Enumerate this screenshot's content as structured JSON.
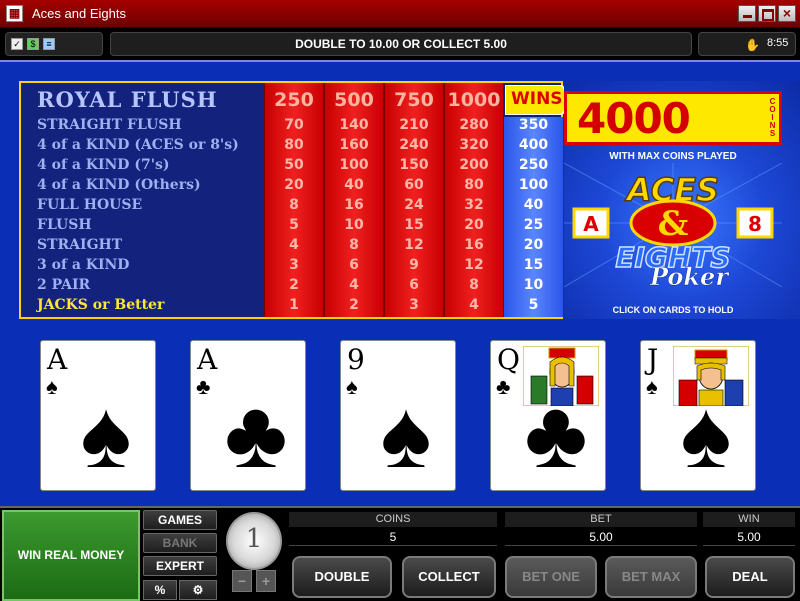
{
  "window": {
    "title": "Aces and Eights",
    "close_glyph": "×",
    "app_icon_glyph": "▦"
  },
  "infobar": {
    "message": "DOUBLE TO 10.00 OR COLLECT 5.00",
    "clock": "8:55",
    "icons": [
      "checklist-icon",
      "money-icon",
      "info-icon"
    ],
    "sound_glyph": "✋"
  },
  "paytable": {
    "hands": [
      "ROYAL FLUSH",
      "STRAIGHT FLUSH",
      "4 of a KIND (ACES or 8's)",
      "4 of a KIND (7's)",
      "4 of a KIND (Others)",
      "FULL HOUSE",
      "FLUSH",
      "STRAIGHT",
      "3 of a KIND",
      "2 PAIR",
      "JACKS or Better"
    ],
    "columns": [
      {
        "head": "250",
        "values": [
          "70",
          "80",
          "50",
          "20",
          "8",
          "5",
          "4",
          "3",
          "2",
          "1"
        ]
      },
      {
        "head": "500",
        "values": [
          "140",
          "160",
          "100",
          "40",
          "16",
          "10",
          "8",
          "6",
          "4",
          "2"
        ]
      },
      {
        "head": "750",
        "values": [
          "210",
          "240",
          "150",
          "60",
          "24",
          "15",
          "12",
          "9",
          "6",
          "3"
        ]
      },
      {
        "head": "1000",
        "values": [
          "280",
          "320",
          "200",
          "80",
          "32",
          "20",
          "16",
          "12",
          "8",
          "4"
        ]
      }
    ],
    "wins_label": "WINS",
    "wins": [
      "350",
      "400",
      "250",
      "100",
      "40",
      "25",
      "20",
      "15",
      "10",
      "5"
    ]
  },
  "promo": {
    "jackpot": "4000",
    "jackpot_unit": "COINS",
    "max_coins": "WITH MAX COINS PLAYED",
    "logo_aces": "ACES",
    "logo_a": "A",
    "logo_amp": "&",
    "logo_8": "8",
    "logo_eights": "EIGHTS",
    "logo_poker": "Poker",
    "click_hold": "CLICK ON CARDS TO HOLD"
  },
  "cards": [
    {
      "rank": "A",
      "suit": "♠",
      "suit_name": "spades"
    },
    {
      "rank": "A",
      "suit": "♣",
      "suit_name": "clubs"
    },
    {
      "rank": "9",
      "suit": "♠",
      "suit_name": "spades"
    },
    {
      "rank": "Q",
      "suit": "♣",
      "suit_name": "clubs"
    },
    {
      "rank": "J",
      "suit": "♠",
      "suit_name": "spades"
    }
  ],
  "console": {
    "win_real_money": "WIN REAL MONEY",
    "games": "GAMES",
    "bank": "BANK",
    "expert": "EXPERT",
    "percent": "%",
    "settings_glyph": "⚙",
    "coin_size": "1",
    "minus": "−",
    "plus": "+",
    "coins_label": "COINS",
    "coins_value": "5",
    "bet_label": "BET",
    "bet_value": "5.00",
    "win_label": "WIN",
    "win_value": "5.00",
    "double": "DOUBLE",
    "collect": "COLLECT",
    "bet_one": "BET ONE",
    "bet_max": "BET MAX",
    "deal": "DEAL"
  },
  "colors": {
    "title_bar": "#8a0000",
    "felt": "#0a2fb6",
    "pay_red": "#e01010",
    "wins_blue": "#4a78ff",
    "jackpot_yellow": "#ffe800",
    "win_real_green": "#2a8a22"
  }
}
